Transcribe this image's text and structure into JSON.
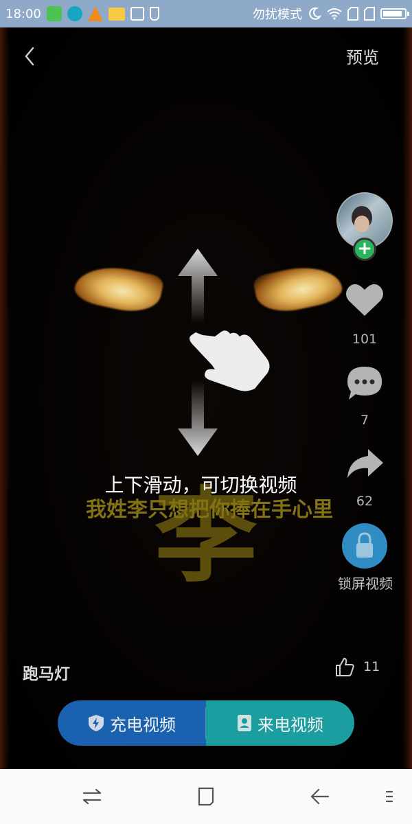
{
  "status_bar": {
    "time": "18:00",
    "dnd_label": "勿扰模式",
    "battery_level": 0.9,
    "notification_icons": [
      "android-app-icon",
      "sync-app-icon",
      "warning-icon",
      "folder-icon",
      "brush-icon",
      "usb-icon"
    ],
    "system_icons": [
      "moon-icon",
      "wifi-icon",
      "sim1-icon",
      "sim2-icon",
      "battery-icon"
    ]
  },
  "top_bar": {
    "back_icon": "chevron-left-icon",
    "preview_label": "预览"
  },
  "video": {
    "big_char": "李",
    "subtitle": "我姓李只想把你捧在手心里",
    "tutorial_text": "上下滑动，可切换视频"
  },
  "right_rail": {
    "follow_symbol": "+",
    "likes": "101",
    "comments": "7",
    "shares": "62",
    "lock_label": "锁屏视频"
  },
  "bottom": {
    "title": "跑马灯",
    "thumbs_count": "11",
    "charge_video_label": "充电视频",
    "call_video_label": "来电视频"
  },
  "colors": {
    "status_bar_bg": "#8fa9c9",
    "charge_button_bg": "#1a62b0",
    "call_button_bg": "#1b9ea0",
    "lock_button_bg": "#2f8dc4",
    "follow_button_bg": "#2bb35e"
  }
}
